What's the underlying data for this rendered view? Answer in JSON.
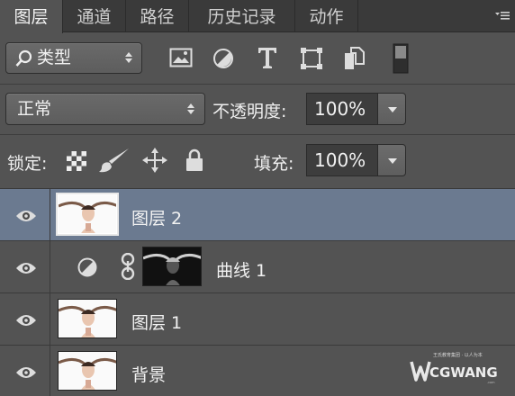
{
  "tabs": [
    {
      "label": "图层",
      "active": true
    },
    {
      "label": "通道",
      "active": false
    },
    {
      "label": "路径",
      "active": false
    },
    {
      "label": "历史记录",
      "active": false
    },
    {
      "label": "动作",
      "active": false
    }
  ],
  "filter": {
    "kind_label": "类型",
    "icons": [
      "image-filter-icon",
      "adjustment-filter-icon",
      "type-filter-icon",
      "shape-filter-icon",
      "smart-object-filter-icon",
      "filter-toggle-icon"
    ]
  },
  "blend": {
    "mode": "正常",
    "opacity_label": "不透明度:",
    "opacity_value": "100%"
  },
  "lock": {
    "label": "锁定:",
    "fill_label": "填充:",
    "fill_value": "100%",
    "icons": [
      "lock-transparent-pixels-icon",
      "lock-image-pixels-icon",
      "lock-position-icon",
      "lock-all-icon"
    ]
  },
  "layers": [
    {
      "name": "图层 2",
      "selected": true,
      "type": "pixel"
    },
    {
      "name": "曲线 1",
      "selected": false,
      "type": "adjustment"
    },
    {
      "name": "图层 1",
      "selected": false,
      "type": "pixel"
    },
    {
      "name": "背景",
      "selected": false,
      "type": "pixel"
    }
  ],
  "watermark": {
    "brand": "CGWANG",
    "tagline": "王氏教育集团 · 以人为本"
  },
  "colors": {
    "panel": "#535353",
    "tabbar": "#3a3a3a",
    "selected_row": "#6b7a90"
  }
}
